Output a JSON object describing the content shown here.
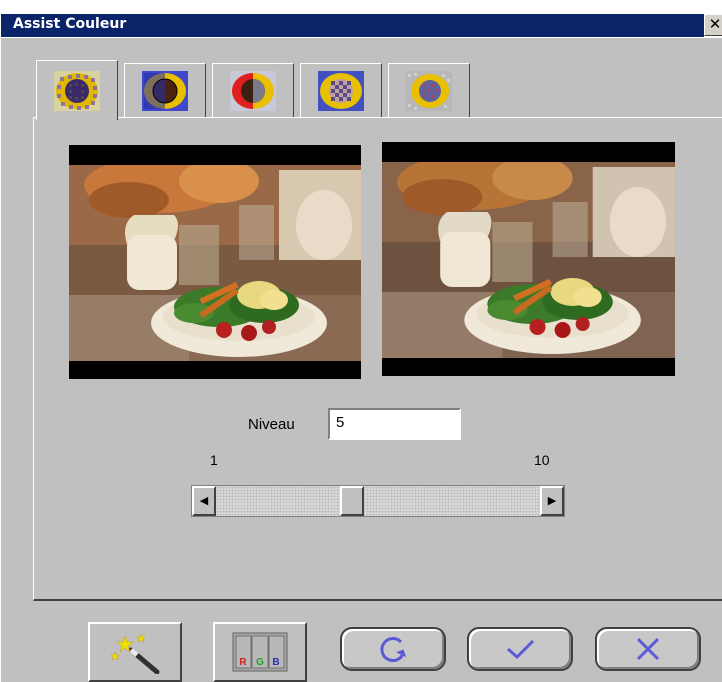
{
  "window": {
    "title": "Assist Couleur",
    "close_glyph": "✕"
  },
  "tabs": [
    {
      "icon": "sunflower-pattern-icon",
      "active": true
    },
    {
      "icon": "sunflower-split-blue-icon",
      "active": false
    },
    {
      "icon": "sunflower-split-red-icon",
      "active": false
    },
    {
      "icon": "sunflower-checker-icon",
      "active": false
    },
    {
      "icon": "sunflower-gray-icon",
      "active": false
    }
  ],
  "previews": {
    "original": "food-still-life-original",
    "adjusted": "food-still-life-adjusted"
  },
  "level": {
    "label": "Niveau",
    "value": "5",
    "min_label": "1",
    "max_label": "10",
    "min": 1,
    "max": 10,
    "current": 5
  },
  "buttons": {
    "wand_icon": "magic-wand-icon",
    "rgb_icon": "rgb-channels-icon",
    "rgb_letters": [
      "R",
      "G",
      "B"
    ],
    "reset_icon": "reset-arrow-icon",
    "ok_icon": "checkmark-icon",
    "cancel_icon": "x-cancel-icon"
  },
  "colors": {
    "title_bar": "#0a246a",
    "face": "#c0c0c0",
    "accent_icon": "#5a5ad8"
  }
}
